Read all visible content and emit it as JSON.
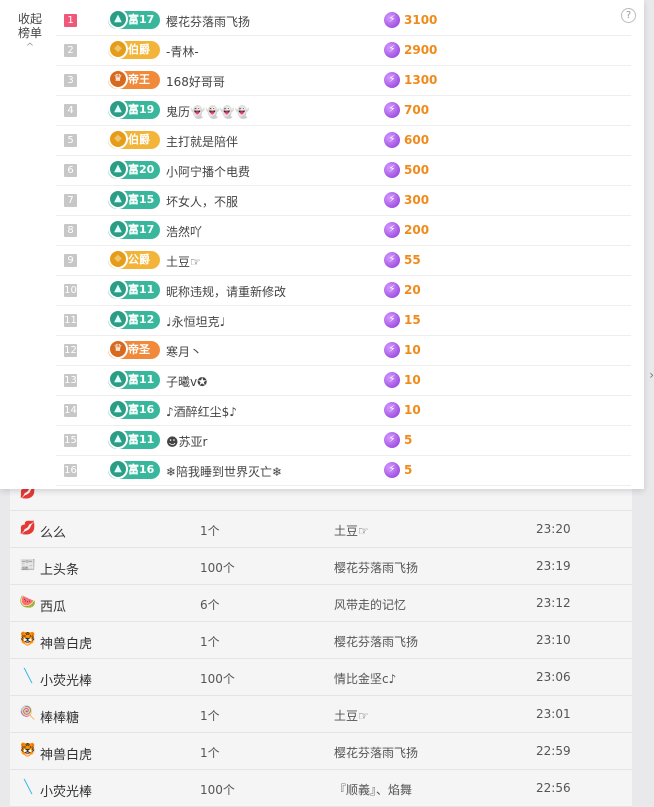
{
  "panel": {
    "collapse_label_line1": "收起",
    "collapse_label_line2": "榜单",
    "collapse_caret": "^",
    "help_glyph": "?"
  },
  "ranking": [
    {
      "rank": "1",
      "badge_type": "rich",
      "badge_label": "富17",
      "name": "樱花芬落雨飞扬",
      "score": "3100"
    },
    {
      "rank": "2",
      "badge_type": "noble",
      "badge_label": "伯爵",
      "name": "-青林-",
      "score": "2900"
    },
    {
      "rank": "3",
      "badge_type": "emperor",
      "badge_label": "帝王",
      "name": "168好哥哥",
      "score": "1300"
    },
    {
      "rank": "4",
      "badge_type": "rich",
      "badge_label": "富19",
      "name": "鬼历👻👻👻👻",
      "score": "700"
    },
    {
      "rank": "5",
      "badge_type": "noble",
      "badge_label": "伯爵",
      "name": "主打就是陪伴",
      "score": "600"
    },
    {
      "rank": "6",
      "badge_type": "rich",
      "badge_label": "富20",
      "name": "小阿宁播个电费",
      "score": "500"
    },
    {
      "rank": "7",
      "badge_type": "rich",
      "badge_label": "富15",
      "name": "坏女人，不服",
      "score": "300"
    },
    {
      "rank": "8",
      "badge_type": "rich",
      "badge_label": "富17",
      "name": "浩然吖",
      "score": "200"
    },
    {
      "rank": "9",
      "badge_type": "noble",
      "badge_label": "公爵",
      "name": "土豆☞",
      "score": "55"
    },
    {
      "rank": "10",
      "badge_type": "rich",
      "badge_label": "富11",
      "name": "昵称违规，请重新修改",
      "score": "20"
    },
    {
      "rank": "11",
      "badge_type": "rich",
      "badge_label": "富12",
      "name": "♩永恒坦克♩",
      "score": "15"
    },
    {
      "rank": "12",
      "badge_type": "emperor",
      "badge_label": "帝圣",
      "name": "寒月丶",
      "score": "10"
    },
    {
      "rank": "13",
      "badge_type": "rich",
      "badge_label": "富11",
      "name": "子曦v✪",
      "score": "10"
    },
    {
      "rank": "14",
      "badge_type": "rich",
      "badge_label": "富16",
      "name": "♪酒醉红尘$♪",
      "score": "10"
    },
    {
      "rank": "15",
      "badge_type": "rich",
      "badge_label": "富11",
      "name": "☻苏亚r",
      "score": "5"
    },
    {
      "rank": "16",
      "badge_type": "rich",
      "badge_label": "富16",
      "name": "❄陪我睡到世界灭亡❄",
      "score": "5"
    }
  ],
  "gifts": [
    {
      "icon": "lips-icon",
      "icon_glyph": "💋",
      "name": "",
      "qty": "",
      "sender": "",
      "time": "",
      "partial": true
    },
    {
      "icon": "lips-icon",
      "icon_glyph": "💋",
      "name": "么么",
      "qty": "1个",
      "sender": "土豆☞",
      "time": "23:20"
    },
    {
      "icon": "headline-icon",
      "icon_glyph": "📰",
      "name": "上头条",
      "qty": "100个",
      "sender": "樱花芬落雨飞扬",
      "time": "23:19"
    },
    {
      "icon": "watermelon-icon",
      "icon_glyph": "🍉",
      "name": "西瓜",
      "qty": "6个",
      "sender": "风带走的记忆",
      "time": "23:12"
    },
    {
      "icon": "white-tiger-icon",
      "icon_glyph": "🐯",
      "name": "神兽白虎",
      "qty": "1个",
      "sender": "樱花芬落雨飞扬",
      "time": "23:10"
    },
    {
      "icon": "glowstick-icon",
      "icon_glyph": "╲",
      "name": "小荧光棒",
      "qty": "100个",
      "sender": "情比金坚c♪",
      "time": "23:06"
    },
    {
      "icon": "lollipop-icon",
      "icon_glyph": "🍭",
      "name": "棒棒糖",
      "qty": "1个",
      "sender": "土豆☞",
      "time": "23:01"
    },
    {
      "icon": "white-tiger-icon",
      "icon_glyph": "🐯",
      "name": "神兽白虎",
      "qty": "1个",
      "sender": "樱花芬落雨飞扬",
      "time": "22:59"
    },
    {
      "icon": "glowstick-icon",
      "icon_glyph": "╲",
      "name": "小荧光棒",
      "qty": "100个",
      "sender": "『顺義』、焰舞",
      "time": "22:56"
    }
  ],
  "colors": {
    "accent_rank1": "#f0587a",
    "score": "#f08a1a",
    "rich_badge": "#39b79c",
    "noble_badge": "#f2b53a",
    "emperor_badge": "#f08a3a"
  }
}
